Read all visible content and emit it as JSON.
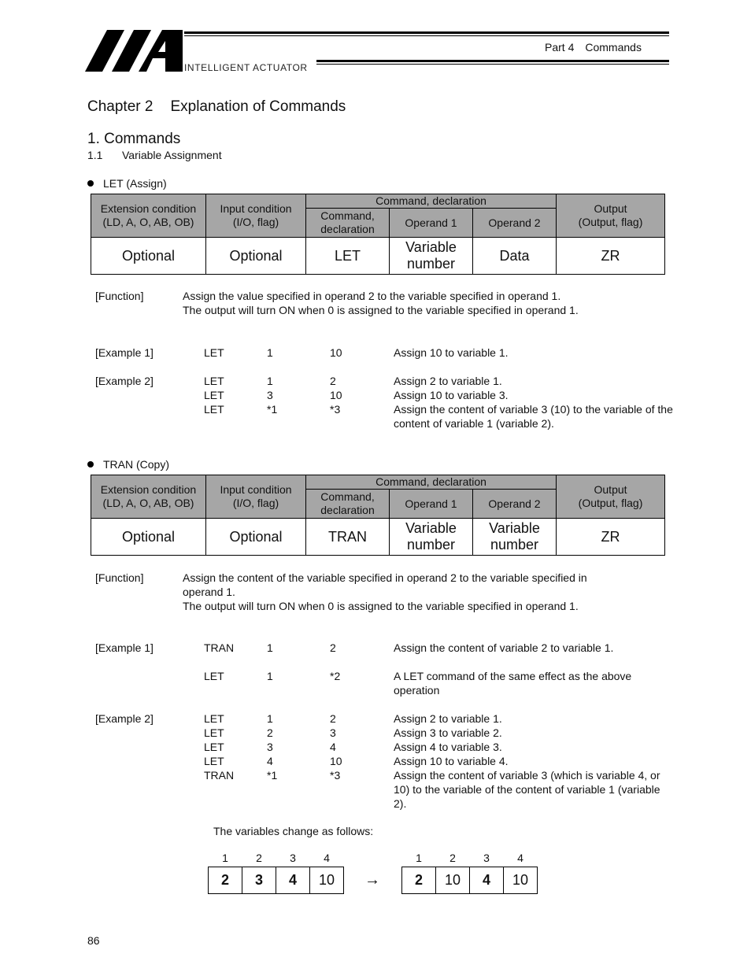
{
  "header": {
    "logo_text": "INTELLIGENT ACTUATOR",
    "part": "Part 4",
    "part_title": "Commands"
  },
  "chapter": {
    "number": "Chapter 2",
    "title": "Explanation of Commands"
  },
  "section": {
    "title": "1.  Commands"
  },
  "subsection": {
    "number": "1.1",
    "title": "Variable Assignment"
  },
  "table_headers": {
    "extension": [
      "Extension condition",
      "(LD, A, O, AB, OB)"
    ],
    "input": [
      "Input condition",
      "(I/O, flag)"
    ],
    "command_group": "Command, declaration",
    "command": [
      "Command,",
      "declaration"
    ],
    "operand1": "Operand 1",
    "operand2": "Operand 2",
    "output": [
      "Output",
      "(Output, flag)"
    ]
  },
  "commands": [
    {
      "bullet": "LET (Assign)",
      "row": {
        "extension": "Optional",
        "input": "Optional",
        "command": "LET",
        "operand1": [
          "Variable",
          "number"
        ],
        "operand2": [
          "Data"
        ],
        "output": "ZR"
      },
      "function_label": "[Function]",
      "function_lines": [
        "Assign the value specified in operand 2 to the variable specified in operand 1.",
        "The output will turn ON when 0 is assigned to the variable specified in operand 1."
      ],
      "examples": [
        {
          "label": "[Example 1]",
          "lines": [
            {
              "cmd": "LET",
              "op1": "1",
              "op2": "10",
              "desc": "Assign 10 to variable 1."
            }
          ]
        },
        {
          "label": "[Example 2]",
          "lines": [
            {
              "cmd": "LET",
              "op1": "1",
              "op2": "2",
              "desc": "Assign 2 to variable 1."
            },
            {
              "cmd": "LET",
              "op1": "3",
              "op2": "10",
              "desc": "Assign 10 to variable 3."
            },
            {
              "cmd": "LET",
              "op1": "*1",
              "op2": "*3",
              "desc": "Assign the content of variable 3 (10) to the variable of the content of variable 1 (variable 2)."
            }
          ]
        }
      ]
    },
    {
      "bullet": "TRAN (Copy)",
      "row": {
        "extension": "Optional",
        "input": "Optional",
        "command": "TRAN",
        "operand1": [
          "Variable",
          "number"
        ],
        "operand2": [
          "Variable",
          "number"
        ],
        "output": "ZR"
      },
      "function_label": "[Function]",
      "function_lines": [
        "Assign the content of the variable specified in operand 2 to the variable specified in",
        "operand 1.",
        "The output will turn ON when 0 is assigned to the variable specified in operand 1."
      ],
      "examples": [
        {
          "label": "[Example 1]",
          "lines": [
            {
              "cmd": "TRAN",
              "op1": "1",
              "op2": "2",
              "desc": "Assign the content of variable 2 to variable 1."
            },
            {
              "cmd": "LET",
              "op1": "1",
              "op2": "*2",
              "desc": "A LET command of the same effect as the above operation"
            }
          ]
        },
        {
          "label": "[Example 2]",
          "lines": [
            {
              "cmd": "LET",
              "op1": "1",
              "op2": "2",
              "desc": "Assign 2 to variable 1."
            },
            {
              "cmd": "LET",
              "op1": "2",
              "op2": "3",
              "desc": "Assign 3 to variable 2."
            },
            {
              "cmd": "LET",
              "op1": "3",
              "op2": "4",
              "desc": "Assign 4 to variable 3."
            },
            {
              "cmd": "LET",
              "op1": "4",
              "op2": "10",
              "desc": "Assign 10 to variable 4."
            },
            {
              "cmd": "TRAN",
              "op1": "*1",
              "op2": "*3",
              "desc": "Assign the content of variable 3 (which is variable 4, or 10) to the variable of the content of variable 1 (variable 2)."
            }
          ]
        }
      ]
    }
  ],
  "variables_change": {
    "caption": "The variables change as follows:",
    "indices": [
      "1",
      "2",
      "3",
      "4"
    ],
    "before": [
      {
        "value": "2",
        "bold": true
      },
      {
        "value": "3",
        "bold": true
      },
      {
        "value": "4",
        "bold": true
      },
      {
        "value": "10",
        "bold": false
      }
    ],
    "arrow": "→",
    "after": [
      {
        "value": "2",
        "bold": true
      },
      {
        "value": "10",
        "bold": false
      },
      {
        "value": "4",
        "bold": true
      },
      {
        "value": "10",
        "bold": false
      }
    ]
  },
  "page_number": "86"
}
